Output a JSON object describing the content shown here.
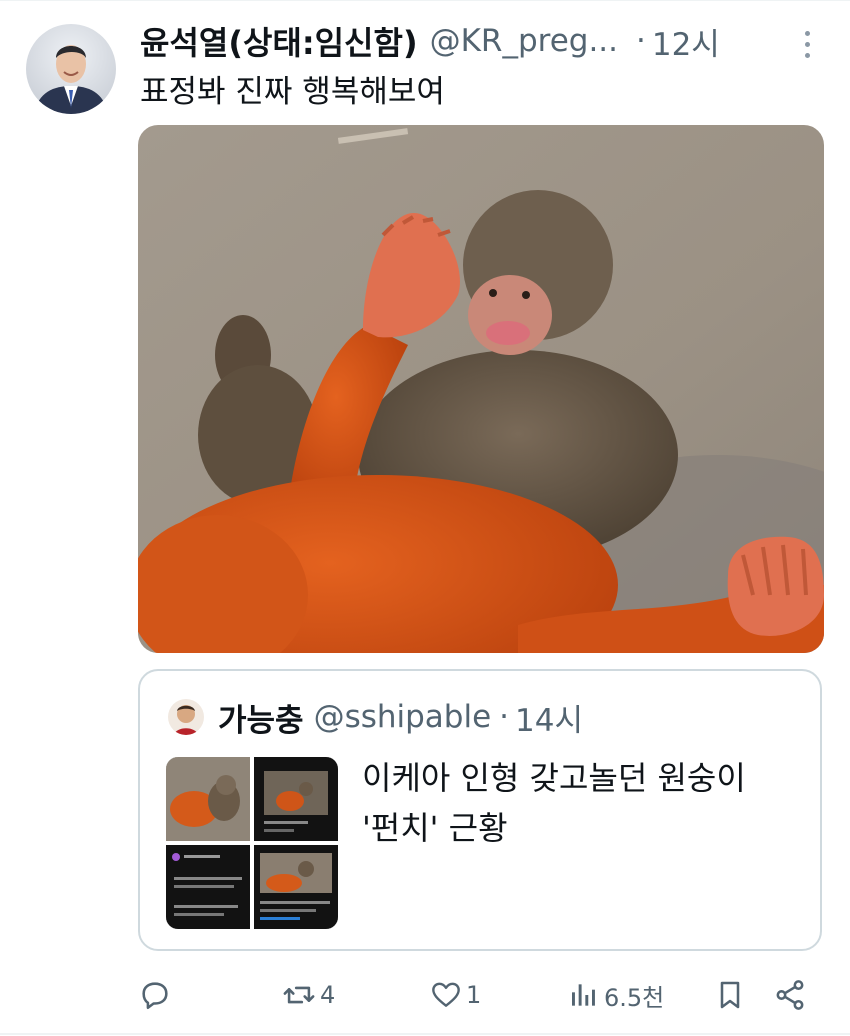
{
  "tweet": {
    "display_name": "윤석열(상태:임신함)",
    "handle": "@KR_preg...",
    "separator": "·",
    "time": "12시",
    "text": "표정봐 진짜 행복해보여"
  },
  "quoted_tweet": {
    "display_name": "가능충",
    "handle": "@sshipable",
    "separator": "·",
    "time": "14시",
    "text_line1": "이케아 인형 갖고놀던 원숭이",
    "text_line2": "'펀치' 근황"
  },
  "actions": {
    "reply_count": "",
    "retweet_count": "4",
    "like_count": "1",
    "view_count": "6.5천"
  },
  "icons": {
    "reply": "reply-icon",
    "retweet": "retweet-icon",
    "like": "heart-icon",
    "views": "views-icon",
    "bookmark": "bookmark-icon",
    "share": "share-icon",
    "more": "more-icon"
  },
  "colors": {
    "text": "#0f1419",
    "secondary": "#536471",
    "border": "#cfd9de",
    "divider": "#eff3f4",
    "icon": "#536471"
  }
}
